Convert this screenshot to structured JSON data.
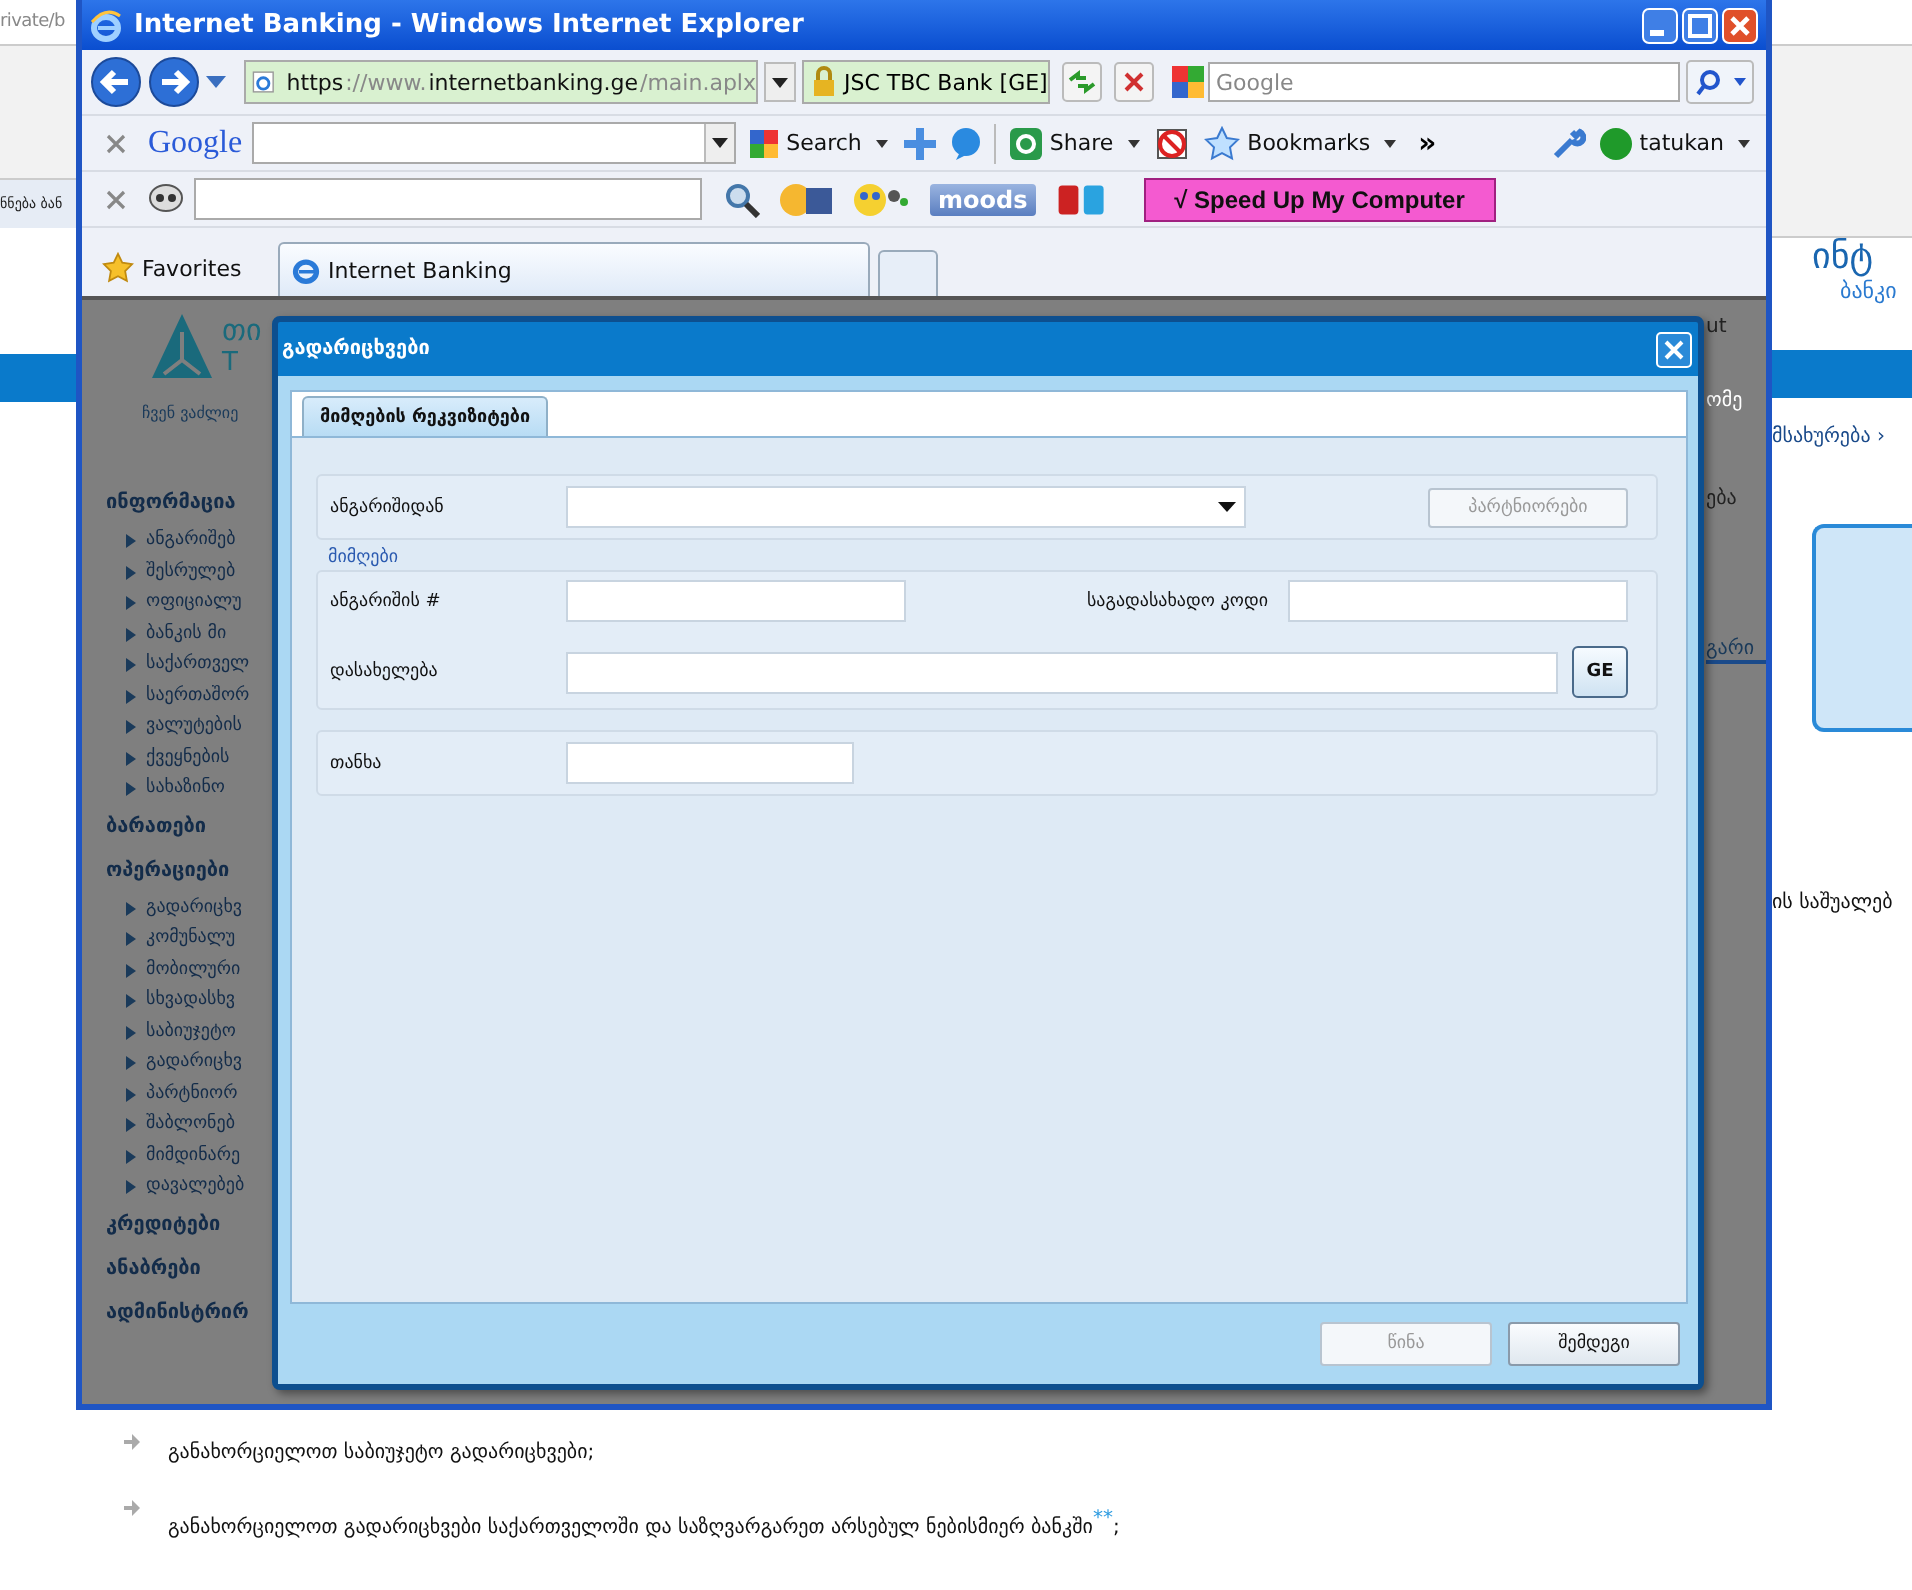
{
  "background_page": {
    "address_fragment": "rivate/b",
    "tab_fragment": "ნნება ბან",
    "logo_line_1": "ინტ",
    "logo_line_2": "ბანკი",
    "nav_fragment": "მსახურება ›",
    "text_fragment": "ის საშუალებ",
    "bullets": [
      {
        "text": "განახორციელოთ საბიუჯეტო გადარიცხვები;"
      },
      {
        "text": "განახორციელოთ გადარიცხვები საქართველოში და საზღვარგარეთ არსებულ ნებისმიერ ბანკში",
        "mark": "**",
        "end": ";"
      }
    ]
  },
  "browser": {
    "title": "Internet Banking - Windows Internet Explorer",
    "url_parts": [
      {
        "text": "https",
        "strong": true
      },
      {
        "text": "://www.",
        "strong": false
      },
      {
        "text": "internetbanking.ge",
        "strong": true
      },
      {
        "text": "/main.aplx",
        "strong": false
      }
    ],
    "certificate": "JSC TBC Bank [GE]",
    "search_placeholder": "Google",
    "google_toolbar": {
      "logo": "Google",
      "search": "Search",
      "share": "Share",
      "bookmarks": "Bookmarks",
      "more": "»",
      "user": "tatukan"
    },
    "extra_toolbar": {
      "moods": "moods",
      "speed_up": "√ Speed Up My Computer"
    },
    "favorites": "Favorites",
    "tabs": [
      {
        "label": "Internet Banking",
        "selected": true
      }
    ]
  },
  "site": {
    "logo_top": "თი",
    "logo_bottom": "T",
    "tagline": "ჩვენ ვაძლიე",
    "menu": [
      {
        "label": "ინფორმაცია",
        "children": [
          {
            "label": "ანგარიშებ"
          },
          {
            "label": "შესრულებ"
          },
          {
            "label": "ოფიციალუ"
          },
          {
            "label": "ბანკის მი"
          },
          {
            "label": "საქართველ"
          },
          {
            "label": "საერთაშორ"
          },
          {
            "label": "ვალუტების"
          },
          {
            "label": "ქვეყნების"
          },
          {
            "label": "სახაზინო"
          }
        ]
      },
      {
        "label": "ბარათები"
      },
      {
        "label": "ოპერაციები",
        "children": [
          {
            "label": "გადარიცხვ"
          },
          {
            "label": "კომუნალუ"
          },
          {
            "label": "მობილური"
          },
          {
            "label": "სხვადასხვ"
          },
          {
            "label": "საბიუჯეტო"
          },
          {
            "label": "გადარიცხვ"
          },
          {
            "label": "პარტნიორ"
          },
          {
            "label": "შაბლონებ"
          },
          {
            "label": "მიმდინარე"
          },
          {
            "label": "დავალებებ"
          }
        ]
      },
      {
        "label": "კრედიტები"
      },
      {
        "label": "ანაბრები"
      },
      {
        "label": "ადმინისტრირ"
      }
    ],
    "right_fragments": [
      "ut",
      "ომე",
      "ება",
      "გარი"
    ]
  },
  "dialog": {
    "title": "გადარიცხვები",
    "tabs": [
      {
        "label": "მიმღების რეკვიზიტები",
        "selected": true
      }
    ],
    "from_label": "ანგარიშიდან",
    "partners_button": {
      "label": "პარტნიორები",
      "disabled": true
    },
    "recipient_legend": "მიმღები",
    "account_label": "ანგარიშის #",
    "tax_code_label": "საგადასახადო კოდი",
    "name_label": "დასახელება",
    "lang_button": "GE",
    "amount_label": "თანხა",
    "buttons": [
      {
        "label": "წინა",
        "disabled": true
      },
      {
        "label": "შემდეგი",
        "disabled": false
      }
    ]
  }
}
